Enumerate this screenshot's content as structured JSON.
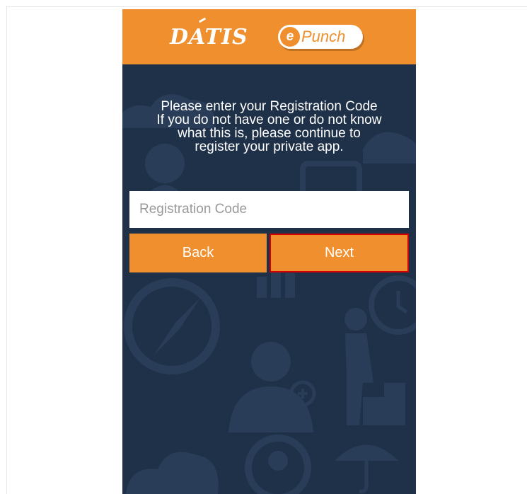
{
  "header": {
    "brand": "DATIS",
    "product_prefix": "e",
    "product_name": "Punch"
  },
  "message": {
    "line1": "Please enter your Registration Code",
    "line2": "If you do not have one or do not know",
    "line3": "what this is, please continue to",
    "line4": "register your private app."
  },
  "form": {
    "registration_code_placeholder": "Registration Code",
    "registration_code_value": ""
  },
  "buttons": {
    "back_label": "Back",
    "next_label": "Next"
  },
  "colors": {
    "header": "#ef8f2d",
    "background": "#1f3049",
    "button": "#ef8f2d",
    "highlight_border": "#d40000"
  }
}
